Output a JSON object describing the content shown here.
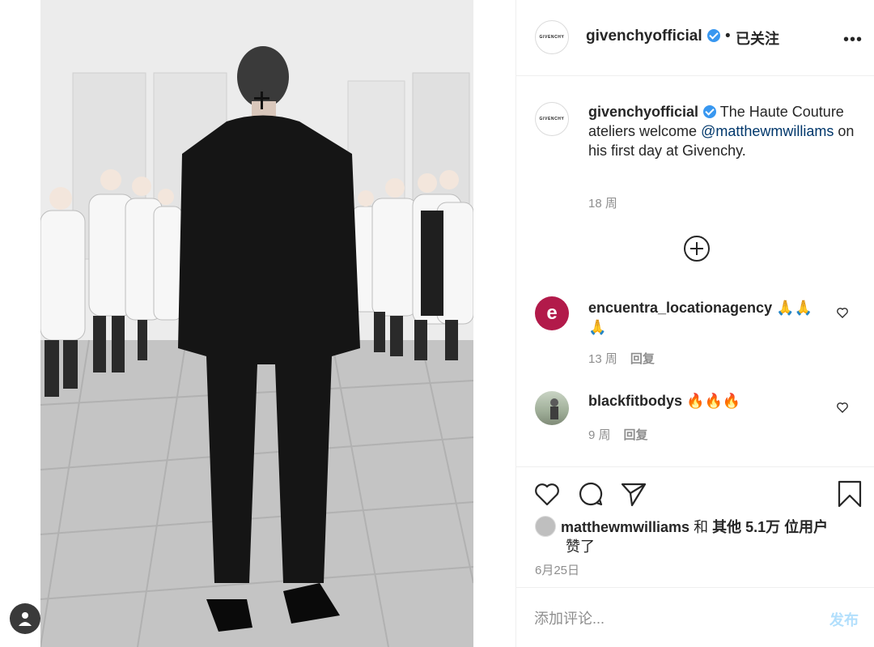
{
  "post": {
    "brand_logo_text": "GIVENCHY",
    "username": "givenchyofficial",
    "follow_status": "已关注",
    "separator": "•",
    "more_icon": "more-horizontal-icon"
  },
  "caption": {
    "username": "givenchyofficial",
    "text_before": "The Haute Couture ateliers welcome ",
    "mention": "@matthewmwilliams",
    "text_after": " on his first day at Givenchy.",
    "time": "18 周"
  },
  "load_more_icon": "plus-circle-icon",
  "comments": [
    {
      "username": "encuentra_locationagency",
      "text": "🙏🙏🙏",
      "time": "13 周",
      "reply_label": "回复",
      "avatar_letter": "e"
    },
    {
      "username": "blackfitbodys",
      "text": "🔥🔥🔥",
      "time": "9 周",
      "reply_label": "回复"
    }
  ],
  "likes": {
    "user": "matthewmwilliams",
    "and": "和",
    "others": "其他 5.1万 位用户",
    "liked": "赞了"
  },
  "date": "6月25日",
  "comment_box": {
    "placeholder": "添加评论...",
    "post_label": "发布"
  },
  "colors": {
    "accent": "#3897f0",
    "post_disabled": "#b2dffc",
    "secondary_text": "#8e8e8e",
    "mention": "#00376b"
  }
}
